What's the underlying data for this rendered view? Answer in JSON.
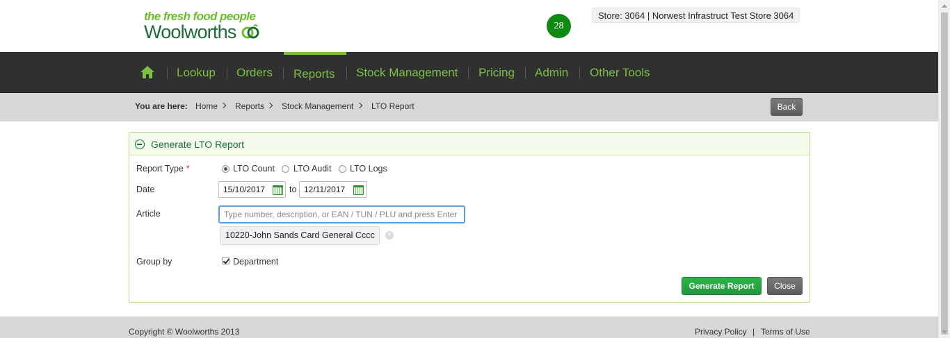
{
  "header": {
    "tagline": "the fresh food people",
    "brand": "Woolworths",
    "badge_count": "28",
    "store": "Store: 3064 | Norwest Infrastruct Test Store 3064"
  },
  "nav": {
    "items": [
      {
        "label": "Lookup"
      },
      {
        "label": "Orders"
      },
      {
        "label": "Reports",
        "active": true
      },
      {
        "label": "Stock Management"
      },
      {
        "label": "Pricing"
      },
      {
        "label": "Admin"
      },
      {
        "label": "Other Tools"
      }
    ]
  },
  "breadcrumb": {
    "label": "You are here:",
    "items": [
      "Home",
      "Reports",
      "Stock Management",
      "LTO Report"
    ],
    "back_label": "Back"
  },
  "panel": {
    "title": "Generate LTO Report",
    "report_type": {
      "label": "Report Type",
      "required_mark": "*",
      "options": [
        "LTO Count",
        "LTO Audit",
        "LTO Logs"
      ],
      "selected": "LTO Count"
    },
    "date": {
      "label": "Date",
      "from": "15/10/2017",
      "to_text": "to",
      "to": "12/11/2017"
    },
    "article": {
      "label": "Article",
      "placeholder": "Type number, description, or EAN / TUN / PLU and press Enter",
      "selected_chip": "10220-John Sands Card General Cccc"
    },
    "group_by": {
      "label": "Group by",
      "option": "Department",
      "checked": true
    },
    "generate_label": "Generate Report",
    "close_label": "Close"
  },
  "footer": {
    "copyright": "Copyright © Woolworths 2013",
    "privacy": "Privacy Policy",
    "separator": "|",
    "terms": "Terms of Use"
  },
  "colors": {
    "brand_green": "#1e6b3a",
    "accent_green": "#7bc142",
    "nav_bg": "#303030",
    "button_green": "#2db34a"
  }
}
